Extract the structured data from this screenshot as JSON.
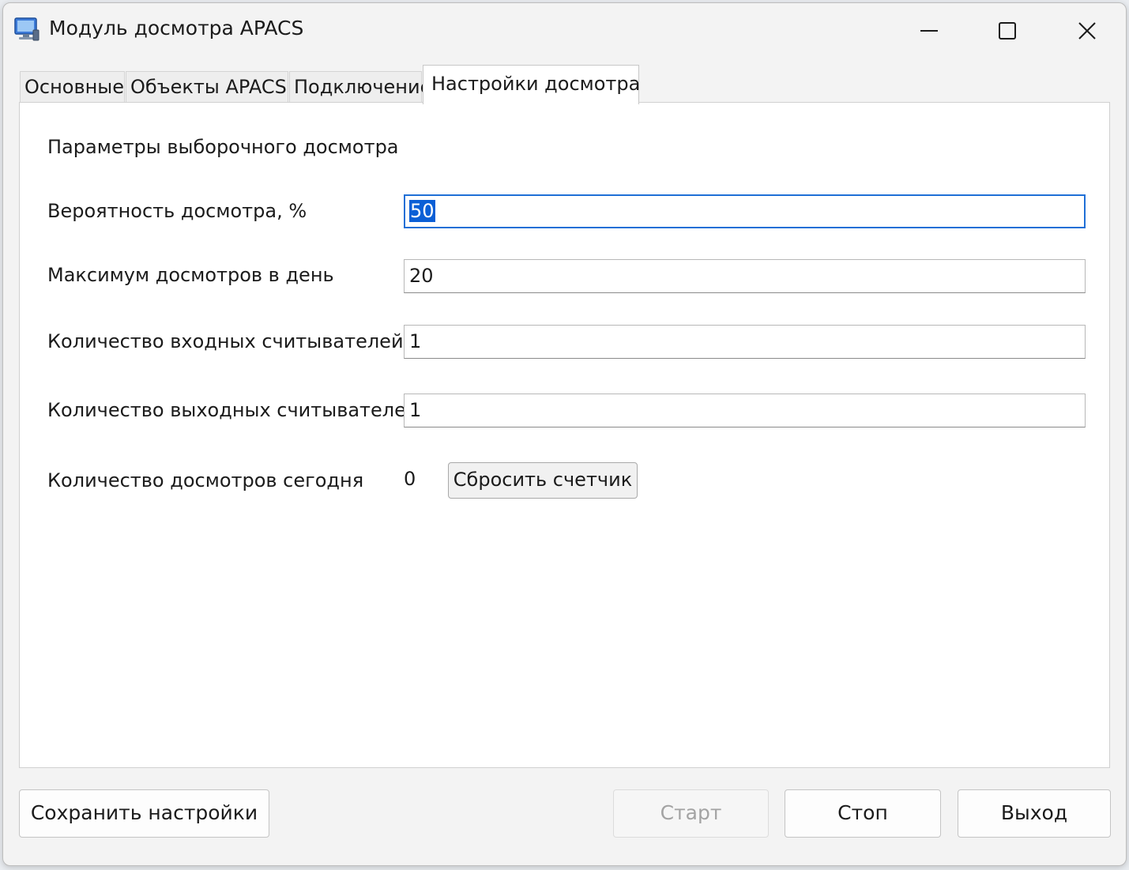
{
  "window": {
    "title": "Модуль досмотра APACS",
    "icon": "computer-monitor-icon"
  },
  "titlebar_buttons": {
    "minimize_icon": "minimize-icon",
    "maximize_icon": "maximize-icon",
    "close_icon": "close-icon"
  },
  "tabs": [
    {
      "label": "Основные",
      "active": false
    },
    {
      "label": "Объекты APACS",
      "active": false
    },
    {
      "label": "Подключение",
      "active": false
    },
    {
      "label": "Настройки досмотра",
      "active": true
    }
  ],
  "panel": {
    "section_title": "Параметры выборочного досмотра",
    "fields": [
      {
        "label": "Вероятность досмотра, %",
        "value": "50",
        "selected": true
      },
      {
        "label": "Максимум досмотров в день",
        "value": "20",
        "selected": false
      },
      {
        "label": "Количество входных считывателей",
        "value": "1",
        "selected": false
      },
      {
        "label": "Количество выходных считывателей",
        "value": "1",
        "selected": false
      }
    ],
    "counter": {
      "label": "Количество досмотров сегодня",
      "value": "0",
      "reset_label": "Сбросить счетчик"
    }
  },
  "buttons": {
    "save": "Сохранить настройки",
    "start": "Старт",
    "stop": "Стоп",
    "exit": "Выход"
  },
  "colors": {
    "focus_border": "#1f6fd6",
    "selection": "#0a5fd6",
    "disabled_text": "#a3a3a3"
  }
}
